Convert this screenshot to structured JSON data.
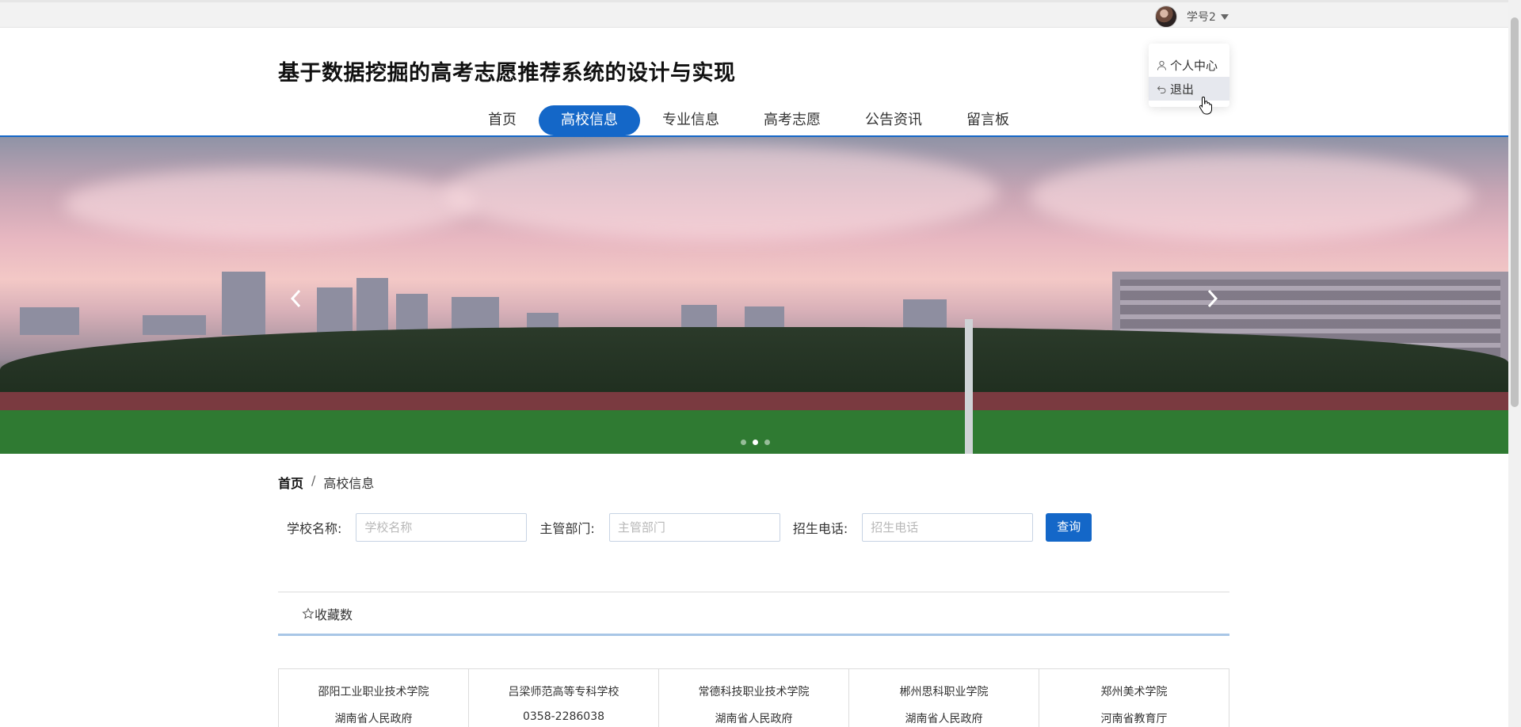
{
  "user": {
    "name": "学号2"
  },
  "dropdown": {
    "items": [
      {
        "label": "个人中心",
        "icon": "user-icon"
      },
      {
        "label": "退出",
        "icon": "logout-icon"
      }
    ]
  },
  "site": {
    "title": "基于数据挖掘的高考志愿推荐系统的设计与实现"
  },
  "nav": {
    "items": [
      "首页",
      "高校信息",
      "专业信息",
      "高考志愿",
      "公告资讯",
      "留言板"
    ],
    "active": "高校信息"
  },
  "banner": {
    "slide_count": 3,
    "active_slide": 2
  },
  "breadcrumb": {
    "home": "首页",
    "sep": "/",
    "current": "高校信息"
  },
  "search": {
    "school_label": "学校名称:",
    "school_placeholder": "学校名称",
    "dept_label": "主管部门:",
    "dept_placeholder": "主管部门",
    "phone_label": "招生电话:",
    "phone_placeholder": "招生电话",
    "button": "查询"
  },
  "sort": {
    "label": "收藏数"
  },
  "cards": [
    {
      "name": "邵阳工业职业技术学院",
      "sub": "湖南省人民政府"
    },
    {
      "name": "吕梁师范高等专科学校",
      "sub": "0358-2286038"
    },
    {
      "name": "常德科技职业技术学院",
      "sub": "湖南省人民政府"
    },
    {
      "name": "郴州思科职业学院",
      "sub": "湖南省人民政府"
    },
    {
      "name": "郑州美术学院",
      "sub": "河南省教育厅"
    }
  ],
  "colors": {
    "primary": "#1467c8",
    "accent_line": "#a8c6e6"
  }
}
